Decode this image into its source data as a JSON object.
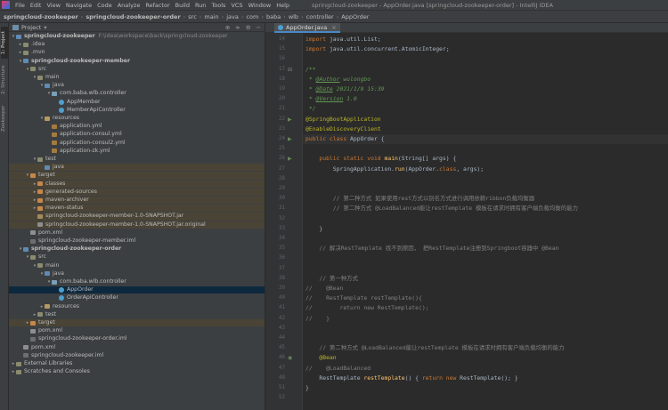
{
  "window": {
    "title": "springcloud-zookeeper - AppOrder.java [springcloud-zookeeper-order] - IntelliJ IDEA",
    "menu": [
      "File",
      "Edit",
      "View",
      "Navigate",
      "Code",
      "Analyze",
      "Refactor",
      "Build",
      "Run",
      "Tools",
      "VCS",
      "Window",
      "Help"
    ]
  },
  "breadcrumb": [
    "springcloud-zookeeper",
    "springcloud-zookeeper-order",
    "src",
    "main",
    "java",
    "com",
    "baba",
    "wlb",
    "controller",
    "AppOrder"
  ],
  "sidebar_tabs": [
    "1: Project",
    "2: Structure",
    "Zookeeper"
  ],
  "project_panel": {
    "title": "Project",
    "tree": [
      {
        "label": "springcloud-zookeeper",
        "extra": "F:\\idea\\workspace\\back\\springcloud-zookeeper",
        "icon": "mod",
        "depth": 0,
        "open": true,
        "bold": true
      },
      {
        "label": ".idea",
        "icon": "folder",
        "depth": 1,
        "open": false
      },
      {
        "label": ".mvn",
        "icon": "folder",
        "depth": 1,
        "open": false
      },
      {
        "label": "springcloud-zookeeper-member",
        "icon": "mod",
        "depth": 1,
        "open": true,
        "bold": true
      },
      {
        "label": "src",
        "icon": "folder",
        "depth": 2,
        "open": true
      },
      {
        "label": "main",
        "icon": "folder",
        "depth": 3,
        "open": true
      },
      {
        "label": "java",
        "icon": "src",
        "depth": 4,
        "open": true
      },
      {
        "label": "com.baba.wlb.controller",
        "icon": "pkg",
        "depth": 5,
        "open": true
      },
      {
        "label": "AppMember",
        "icon": "class",
        "depth": 6
      },
      {
        "label": "MemberApiController",
        "icon": "class",
        "depth": 6
      },
      {
        "label": "resources",
        "icon": "res",
        "depth": 4,
        "open": true
      },
      {
        "label": "application.yml",
        "icon": "yml",
        "depth": 5
      },
      {
        "label": "application-consul.yml",
        "icon": "yml",
        "depth": 5
      },
      {
        "label": "application-consul2.yml",
        "icon": "yml",
        "depth": 5
      },
      {
        "label": "application-zk.yml",
        "icon": "yml",
        "depth": 5
      },
      {
        "label": "test",
        "icon": "folder",
        "depth": 3,
        "open": true
      },
      {
        "label": "java",
        "icon": "src",
        "depth": 4,
        "tint": true
      },
      {
        "label": "target",
        "icon": "target",
        "depth": 2,
        "open": true,
        "tint": true
      },
      {
        "label": "classes",
        "icon": "target",
        "depth": 3,
        "open": false,
        "tint": true
      },
      {
        "label": "generated-sources",
        "icon": "target",
        "depth": 3,
        "open": false,
        "tint": true
      },
      {
        "label": "maven-archiver",
        "icon": "target",
        "depth": 3,
        "open": false,
        "tint": true
      },
      {
        "label": "maven-status",
        "icon": "target",
        "depth": 3,
        "open": false,
        "tint": true
      },
      {
        "label": "springcloud-zookeeper-member-1.0-SNAPSHOT.jar",
        "icon": "jar",
        "depth": 3,
        "tint": true
      },
      {
        "label": "springcloud-zookeeper-member-1.0-SNAPSHOT.jar.original",
        "icon": "file",
        "depth": 3,
        "tint": true
      },
      {
        "label": "pom.xml",
        "icon": "file",
        "depth": 2
      },
      {
        "label": "springcloud-zookeeper-member.iml",
        "icon": "iml",
        "depth": 2
      },
      {
        "label": "springcloud-zookeeper-order",
        "icon": "mod",
        "depth": 1,
        "open": true,
        "bold": true
      },
      {
        "label": "src",
        "icon": "folder",
        "depth": 2,
        "open": true
      },
      {
        "label": "main",
        "icon": "folder",
        "depth": 3,
        "open": true
      },
      {
        "label": "java",
        "icon": "src",
        "depth": 4,
        "open": true
      },
      {
        "label": "com.baba.wlb.controller",
        "icon": "pkg",
        "depth": 5,
        "open": true
      },
      {
        "label": "AppOrder",
        "icon": "class",
        "depth": 6,
        "selected": true
      },
      {
        "label": "OrderApiController",
        "icon": "class",
        "depth": 6
      },
      {
        "label": "resources",
        "icon": "res",
        "depth": 4,
        "open": false
      },
      {
        "label": "test",
        "icon": "folder",
        "depth": 3,
        "open": false
      },
      {
        "label": "target",
        "icon": "target",
        "depth": 2,
        "open": false,
        "tint": true
      },
      {
        "label": "pom.xml",
        "icon": "file",
        "depth": 2
      },
      {
        "label": "springcloud-zookeeper-order.iml",
        "icon": "iml",
        "depth": 2
      },
      {
        "label": "pom.xml",
        "icon": "file",
        "depth": 1
      },
      {
        "label": "springcloud-zookeeper.iml",
        "icon": "iml",
        "depth": 1
      },
      {
        "label": "External Libraries",
        "icon": "folder",
        "depth": 0,
        "open": false
      },
      {
        "label": "Scratches and Consoles",
        "icon": "folder",
        "depth": 0,
        "open": false
      }
    ]
  },
  "editor": {
    "tab_label": "AppOrder.java",
    "lines": [
      {
        "n": "14",
        "parts": [
          [
            "kw",
            "import "
          ],
          [
            "",
            "java.util.List;"
          ]
        ]
      },
      {
        "n": "15",
        "parts": [
          [
            "kw",
            "import "
          ],
          [
            "",
            "java.util.concurrent.AtomicInteger;"
          ]
        ]
      },
      {
        "n": "16",
        "parts": []
      },
      {
        "n": "17",
        "parts": [
          [
            "dc",
            "/**"
          ]
        ]
      },
      {
        "n": "18",
        "parts": [
          [
            "dc",
            " * "
          ],
          [
            "tg",
            "@Author"
          ],
          [
            "dc",
            " wulongbo"
          ]
        ]
      },
      {
        "n": "19",
        "parts": [
          [
            "dc",
            " * "
          ],
          [
            "tg",
            "@Date"
          ],
          [
            "dc",
            " 2021/1/9 15:39"
          ]
        ]
      },
      {
        "n": "20",
        "parts": [
          [
            "dc",
            " * "
          ],
          [
            "tg",
            "@Version"
          ],
          [
            "dc",
            " 1.0"
          ]
        ]
      },
      {
        "n": "21",
        "parts": [
          [
            "dc",
            " */"
          ]
        ]
      },
      {
        "n": "22",
        "parts": [
          [
            "an",
            "@SpringBootApplication"
          ]
        ]
      },
      {
        "n": "23",
        "parts": [
          [
            "an",
            "@EnableDiscoveryClient"
          ]
        ]
      },
      {
        "n": "24",
        "parts": [
          [
            "kw",
            "public class "
          ],
          [
            "",
            "AppOrder {"
          ]
        ],
        "current": true
      },
      {
        "n": "25",
        "parts": []
      },
      {
        "n": "26",
        "parts": [
          [
            "kw",
            "    public static void "
          ],
          [
            "fn",
            "main"
          ],
          [
            "",
            "(String[] args) {"
          ]
        ]
      },
      {
        "n": "27",
        "parts": [
          [
            "",
            "        SpringApplication."
          ],
          [
            "fn",
            "run"
          ],
          [
            "",
            "(AppOrder."
          ],
          [
            "kw",
            "class"
          ],
          [
            "",
            ", args);"
          ]
        ]
      },
      {
        "n": "28",
        "parts": []
      },
      {
        "n": "29",
        "parts": []
      },
      {
        "n": "30",
        "parts": [
          [
            "cm",
            "        // 第二种方式 如果使用rest方式以别名方式进行调用依赖ribbon负载均衡器"
          ]
        ]
      },
      {
        "n": "31",
        "parts": [
          [
            "cm",
            "        // 第二种方式 @LoadBalanced能让restTemplate 模板在请求时拥有客户端负载均衡的能力"
          ]
        ]
      },
      {
        "n": "32",
        "parts": []
      },
      {
        "n": "33",
        "parts": [
          [
            "",
            "    }"
          ]
        ]
      },
      {
        "n": "34",
        "parts": []
      },
      {
        "n": "35",
        "parts": [
          [
            "cm",
            "    // 解决RestTemplate 找不到原因， 把RestTemplate注册到Springboot容器中 @Bean"
          ]
        ]
      },
      {
        "n": "36",
        "parts": []
      },
      {
        "n": "37",
        "parts": []
      },
      {
        "n": "38",
        "parts": [
          [
            "cm",
            "    // 第一种方式"
          ]
        ]
      },
      {
        "n": "39",
        "parts": [
          [
            "cm",
            "//    @Bean"
          ]
        ]
      },
      {
        "n": "40",
        "parts": [
          [
            "cm",
            "//    RestTemplate restTemplate(){"
          ]
        ]
      },
      {
        "n": "41",
        "parts": [
          [
            "cm",
            "//        return new RestTemplate();"
          ]
        ]
      },
      {
        "n": "42",
        "parts": [
          [
            "cm",
            "//    }"
          ]
        ]
      },
      {
        "n": "43",
        "parts": []
      },
      {
        "n": "44",
        "parts": []
      },
      {
        "n": "45",
        "parts": [
          [
            "cm",
            "    // 第二种方式 @LoadBalanced能让restTemplate 模板在请求时拥有客户端负载均衡的能力"
          ]
        ]
      },
      {
        "n": "46",
        "parts": [
          [
            "an",
            "    @Bean"
          ]
        ]
      },
      {
        "n": "47",
        "parts": [
          [
            "cm",
            "//    @LoadBalanced"
          ]
        ]
      },
      {
        "n": "48",
        "parts": [
          [
            "",
            "    RestTemplate "
          ],
          [
            "fn",
            "restTemplate"
          ],
          [
            "",
            "() { "
          ],
          [
            "kw",
            "return new "
          ],
          [
            "",
            "RestTemplate(); }"
          ]
        ]
      },
      {
        "n": "51",
        "parts": [
          [
            "",
            "}"
          ]
        ]
      },
      {
        "n": "52",
        "parts": []
      }
    ],
    "gutter_marks": {
      "17": "fold",
      "22": "run",
      "24": "run",
      "26": "run",
      "46": "bean"
    }
  }
}
